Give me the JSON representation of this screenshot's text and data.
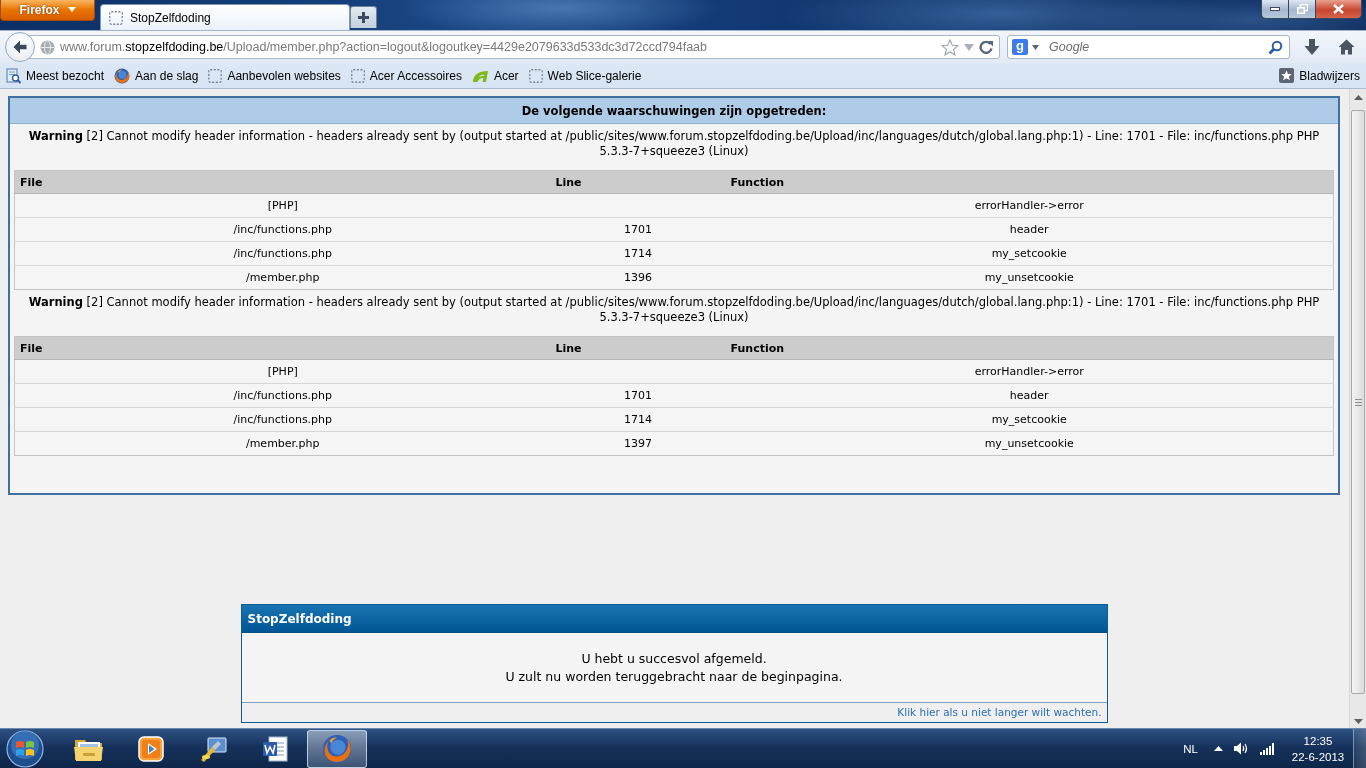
{
  "browser": {
    "app_menu_button": "Firefox",
    "tabs": [
      {
        "title": "StopZelfdoding",
        "selected": true
      }
    ],
    "address_bar": {
      "url_start": "www.forum.",
      "url_domain": "stopzelfdoding.be",
      "url_rest": "/Upload/member.php?action=logout&logoutkey=4429e2079633d533dc3d72ccd794faab"
    },
    "search_bar": {
      "engine_letter": "g",
      "placeholder": "Google"
    },
    "bookmarks": [
      {
        "kind": "most-visited",
        "label": "Meest bezocht"
      },
      {
        "kind": "firefox",
        "label": "Aan de slag"
      },
      {
        "kind": "blank",
        "label": "Aanbevolen websites"
      },
      {
        "kind": "blank",
        "label": "Acer Accessoires"
      },
      {
        "kind": "acer",
        "label": "Acer"
      },
      {
        "kind": "blank",
        "label": "Web Slice-galerie"
      }
    ],
    "bookmarks_menu": "Bladwijzers"
  },
  "page": {
    "warnings_panel": {
      "title": "De volgende waarschuwingen zijn opgetreden:",
      "warnings": [
        {
          "message": "**Warning** [2] Cannot modify header information - headers already sent by (output started at /public/sites/www.forum.stopzelfdoding.be/Upload/inc/languages/dutch/global.lang.php:1) - Line: 1701 - File: inc/functions.php PHP 5.3.3-7+squeeze3 (Linux)",
          "table": {
            "columns": [
              "File",
              "Line",
              "Function"
            ],
            "rows": [
              {
                "file": "[PHP]",
                "function": "errorHandler->error"
              },
              {
                "file": "/inc/functions.php",
                "line": "1701",
                "function": "header"
              },
              {
                "file": "/inc/functions.php",
                "line": "1714",
                "function": "my_setcookie"
              },
              {
                "file": "/member.php",
                "line": "1396",
                "function": "my_unsetcookie"
              }
            ]
          }
        },
        {
          "message": "**Warning** [2] Cannot modify header information - headers already sent by (output started at /public/sites/www.forum.stopzelfdoding.be/Upload/inc/languages/dutch/global.lang.php:1) - Line: 1701 - File: inc/functions.php PHP 5.3.3-7+squeeze3 (Linux)",
          "table": {
            "columns": [
              "File",
              "Line",
              "Function"
            ],
            "rows": [
              {
                "file": "[PHP]",
                "function": "errorHandler->error"
              },
              {
                "file": "/inc/functions.php",
                "line": "1701",
                "function": "header"
              },
              {
                "file": "/inc/functions.php",
                "line": "1714",
                "function": "my_setcookie"
              },
              {
                "file": "/member.php",
                "line": "1397",
                "function": "my_unsetcookie"
              }
            ]
          }
        }
      ]
    },
    "redirect_box": {
      "title": "StopZelfdoding",
      "lines": [
        "U hebt u succesvol afgemeld.",
        "U zult nu worden teruggebracht naar de beginpagina."
      ],
      "link": "Klik hier als u niet langer wilt wachten."
    }
  },
  "taskbar": {
    "apps": [
      {
        "kind": "folder",
        "active": false
      },
      {
        "kind": "media",
        "active": false
      },
      {
        "kind": "paint",
        "active": false
      },
      {
        "kind": "word",
        "active": false
      },
      {
        "kind": "firefox",
        "active": true
      }
    ],
    "tray": {
      "language": "NL",
      "time": "12:35",
      "date": "22-6-2013"
    }
  }
}
